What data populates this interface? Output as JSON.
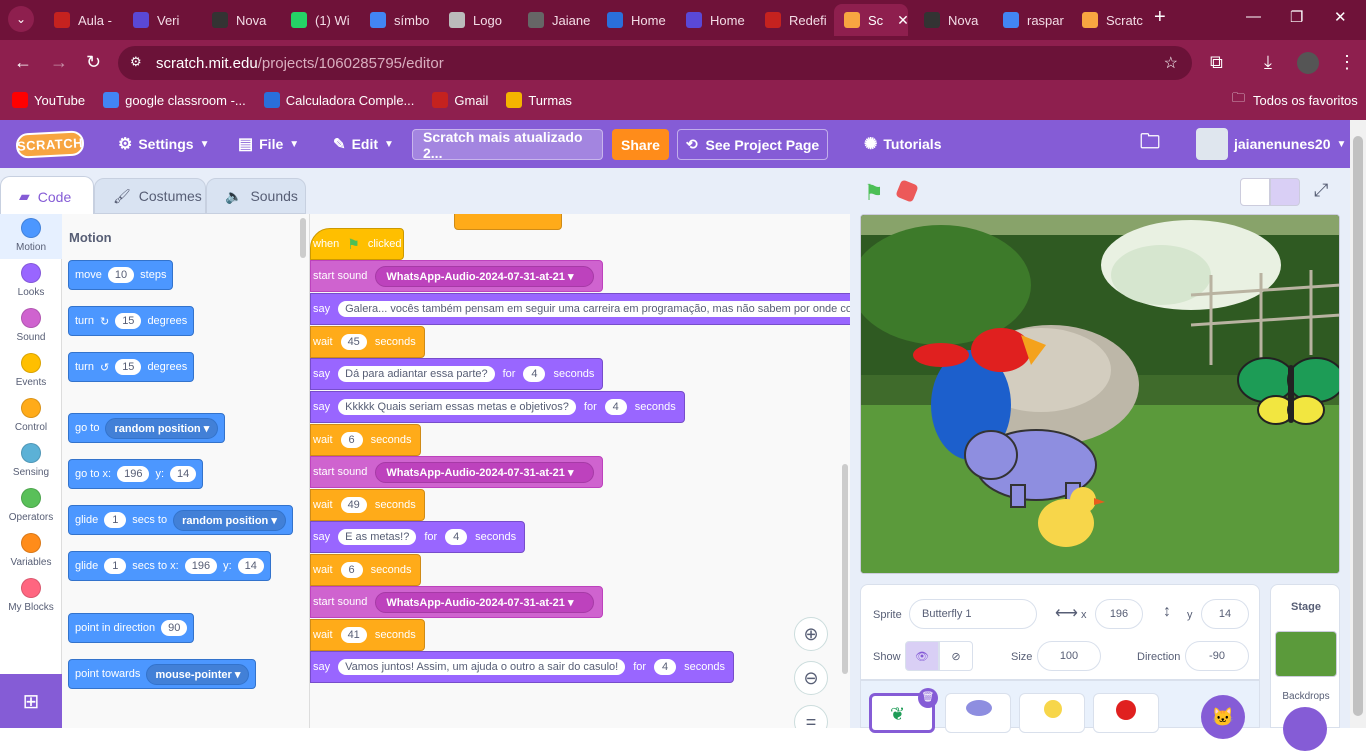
{
  "browser": {
    "tabs": [
      {
        "label": "Aula -",
        "color": "#c5221f",
        "icon": "gmail-icon"
      },
      {
        "label": "Veri",
        "color": "#5a48d6",
        "icon": "doc-icon"
      },
      {
        "label": "Nova",
        "color": "#333333",
        "icon": "chrome-icon"
      },
      {
        "label": "(1) Wi",
        "color": "#25d366",
        "icon": "whatsapp-icon"
      },
      {
        "label": "símbo",
        "color": "#4285f4",
        "icon": "google-icon"
      },
      {
        "label": "Logo",
        "color": "#bbbbbb",
        "icon": "image-icon"
      },
      {
        "label": "Jaiane",
        "color": "#666666",
        "icon": "github-icon"
      },
      {
        "label": "Home",
        "color": "#2a6fdb",
        "icon": "classroom-icon"
      },
      {
        "label": "Home",
        "color": "#5a48d6",
        "icon": "doc-icon"
      },
      {
        "label": "Redefi",
        "color": "#c5221f",
        "icon": "gmail-icon"
      },
      {
        "label": "Sc",
        "color": "#f7a541",
        "icon": "scratch-icon"
      },
      {
        "label": "Nova",
        "color": "#333333",
        "icon": "chrome-icon"
      },
      {
        "label": "raspar",
        "color": "#4285f4",
        "icon": "google-icon"
      },
      {
        "label": "Scratc",
        "color": "#f7a541",
        "icon": "scratch-icon"
      }
    ],
    "url_domain": "scratch.mit.edu",
    "url_path": "/projects/1060285795/editor",
    "bookmarks": [
      {
        "label": "YouTube",
        "color": "#ff0000"
      },
      {
        "label": "google classroom -...",
        "color": "#4285f4"
      },
      {
        "label": "Calculadora Comple...",
        "color": "#2a6fdb"
      },
      {
        "label": "Gmail",
        "color": "#c5221f"
      },
      {
        "label": "Turmas",
        "color": "#f4b400"
      }
    ],
    "all_bookmarks": "Todos os favoritos"
  },
  "menu": {
    "logo": "SCRATCH",
    "settings": "Settings",
    "file": "File",
    "edit": "Edit",
    "project_title": "Scratch mais atualizado 2...",
    "share": "Share",
    "see_project": "See Project Page",
    "tutorials": "Tutorials",
    "username": "jaianenunes20"
  },
  "editor_tabs": {
    "code": "Code",
    "costumes": "Costumes",
    "sounds": "Sounds"
  },
  "categories": [
    {
      "label": "Motion",
      "color": "#4c97ff"
    },
    {
      "label": "Looks",
      "color": "#9966ff"
    },
    {
      "label": "Sound",
      "color": "#cf63cf"
    },
    {
      "label": "Events",
      "color": "#ffbf00"
    },
    {
      "label": "Control",
      "color": "#ffab19"
    },
    {
      "label": "Sensing",
      "color": "#5cb1d6"
    },
    {
      "label": "Operators",
      "color": "#59c059"
    },
    {
      "label": "Variables",
      "color": "#ff8c1a"
    },
    {
      "label": "My Blocks",
      "color": "#ff6680"
    }
  ],
  "palette": {
    "heading": "Motion",
    "move": {
      "a": "move",
      "v": "10",
      "b": "steps"
    },
    "turn_right": {
      "a": "turn",
      "v": "15",
      "b": "degrees"
    },
    "turn_left": {
      "a": "turn",
      "v": "15",
      "b": "degrees"
    },
    "goto": {
      "a": "go to",
      "d": "random position"
    },
    "gotoxy": {
      "a": "go to x:",
      "x": "196",
      "b": "y:",
      "y": "14"
    },
    "glide": {
      "a": "glide",
      "v": "1",
      "b": "secs to",
      "d": "random position"
    },
    "glidexy": {
      "a": "glide",
      "v": "1",
      "b": "secs to x:",
      "x": "196",
      "c": "y:",
      "y": "14"
    },
    "point_dir": {
      "a": "point in direction",
      "v": "90"
    },
    "point_towards": {
      "a": "point towards",
      "d": "mouse-pointer"
    }
  },
  "script": {
    "hat": {
      "a": "when",
      "b": "clicked"
    },
    "blocks": [
      {
        "kind": "snd",
        "a": "start sound",
        "d": "WhatsApp-Audio-2024-07-31-at-21"
      },
      {
        "kind": "look",
        "a": "say",
        "t": "Galera... vocês também pensam em seguir uma carreira em programação, mas não sabem por onde com"
      },
      {
        "kind": "ctl",
        "a": "wait",
        "v": "45",
        "b": "seconds"
      },
      {
        "kind": "look",
        "a": "say",
        "t": "Dá para adiantar essa parte?",
        "f": "for",
        "v": "4",
        "b": "seconds"
      },
      {
        "kind": "look",
        "a": "say",
        "t": "Kkkkk Quais seriam essas metas e objetivos?",
        "f": "for",
        "v": "4",
        "b": "seconds"
      },
      {
        "kind": "ctl",
        "a": "wait",
        "v": "6",
        "b": "seconds"
      },
      {
        "kind": "snd",
        "a": "start sound",
        "d": "WhatsApp-Audio-2024-07-31-at-21"
      },
      {
        "kind": "ctl",
        "a": "wait",
        "v": "49",
        "b": "seconds"
      },
      {
        "kind": "look",
        "a": "say",
        "t": "E as metas!?",
        "f": "for",
        "v": "4",
        "b": "seconds"
      },
      {
        "kind": "ctl",
        "a": "wait",
        "v": "6",
        "b": "seconds"
      },
      {
        "kind": "snd",
        "a": "start sound",
        "d": "WhatsApp-Audio-2024-07-31-at-21"
      },
      {
        "kind": "ctl",
        "a": "wait",
        "v": "41",
        "b": "seconds"
      },
      {
        "kind": "look",
        "a": "say",
        "t": "Vamos juntos! Assim, um ajuda o outro a sair do casulo!",
        "f": "for",
        "v": "4",
        "b": "seconds"
      }
    ]
  },
  "sprite": {
    "label": "Sprite",
    "name": "Butterfly 1",
    "x_label": "x",
    "x": "196",
    "y_label": "y",
    "y": "14",
    "show_label": "Show",
    "size_label": "Size",
    "size": "100",
    "direction_label": "Direction",
    "direction": "-90"
  },
  "stage_panel": {
    "title": "Stage",
    "backdrops": "Backdrops"
  }
}
